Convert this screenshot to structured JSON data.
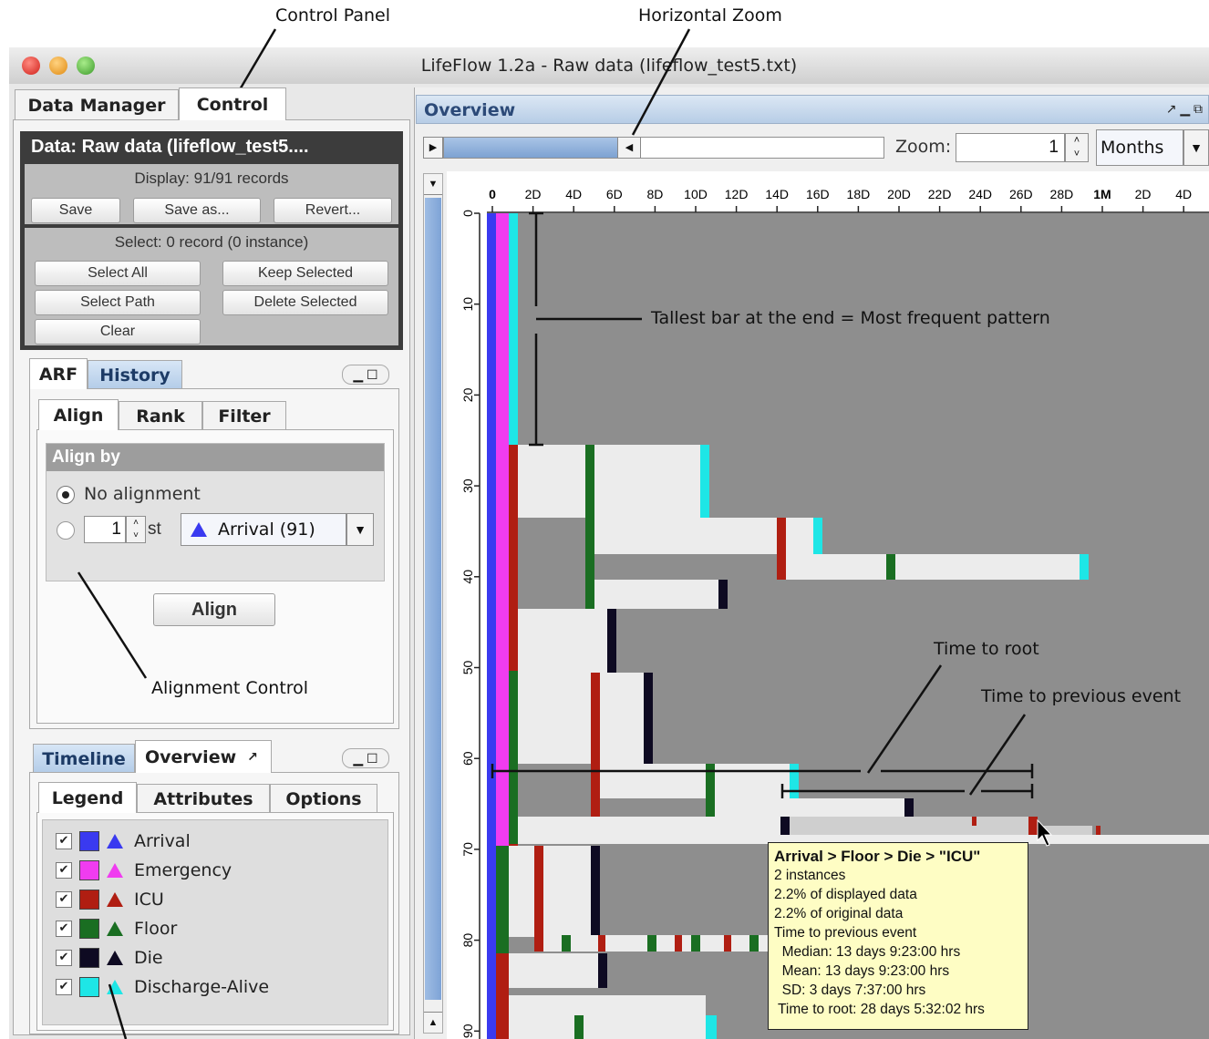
{
  "annotations": {
    "control_panel": "Control Panel",
    "horizontal_zoom": "Horizontal Zoom",
    "tallest_bar": "Tallest bar at the end = Most frequent pattern",
    "time_to_root": "Time to root",
    "time_to_previous": "Time to previous event",
    "alignment_control": "Alignment Control"
  },
  "window": {
    "title": "LifeFlow 1.2a - Raw data (lifeflow_test5.txt)"
  },
  "left": {
    "top_tabs": [
      "Data Manager",
      "Control"
    ],
    "data": {
      "header": "Data: Raw data (lifeflow_test5....",
      "display": "Display: 91/91 records",
      "save": "Save",
      "save_as": "Save as...",
      "revert": "Revert...",
      "select_status": "Select: 0 record (0 instance)",
      "select_all": "Select All",
      "keep_selected": "Keep Selected",
      "select_path": "Select Path",
      "delete_selected": "Delete Selected",
      "clear": "Clear"
    },
    "mid_tabs": [
      "ARF",
      "History"
    ],
    "align_tabs": [
      "Align",
      "Rank",
      "Filter"
    ],
    "align": {
      "header": "Align by",
      "no_alignment": "No alignment",
      "stepper_value": "1",
      "st": "st",
      "event": "Arrival (91)",
      "align_button": "Align"
    },
    "bottom_tabs": [
      "Timeline",
      "Overview"
    ],
    "legend_tabs": [
      "Legend",
      "Attributes",
      "Options"
    ],
    "legend": [
      {
        "label": "Arrival",
        "color": "#3a3af0",
        "checked": true
      },
      {
        "label": "Emergency",
        "color": "#f03cf0",
        "checked": true
      },
      {
        "label": "ICU",
        "color": "#b01e12",
        "checked": true
      },
      {
        "label": "Floor",
        "color": "#1a6e22",
        "checked": true
      },
      {
        "label": "Die",
        "color": "#0e0a22",
        "checked": true
      },
      {
        "label": "Discharge-Alive",
        "color": "#1ee6e6",
        "checked": true
      }
    ]
  },
  "overview": {
    "title": "Overview",
    "zoom_label": "Zoom:",
    "zoom_value": "1",
    "unit": "Months",
    "x_ticks": [
      "0",
      "2D",
      "4D",
      "6D",
      "8D",
      "10D",
      "12D",
      "14D",
      "16D",
      "18D",
      "20D",
      "22D",
      "24D",
      "26D",
      "28D",
      "1M",
      "2D",
      "4D"
    ],
    "y_ticks": [
      "0",
      "10",
      "20",
      "30",
      "40",
      "50",
      "60",
      "70",
      "80",
      "90"
    ]
  },
  "tooltip": {
    "title": "Arrival > Floor > Die > \"ICU\"",
    "lines": [
      "2 instances",
      "2.2% of displayed data",
      "2.2% of original data",
      "Time to previous event",
      "  Median: 13 days 9:23:00 hrs",
      "  Mean: 13 days 9:23:00 hrs",
      "  SD: 3 days 7:37:00 hrs",
      " Time to root: 28 days 5:32:02 hrs"
    ]
  }
}
